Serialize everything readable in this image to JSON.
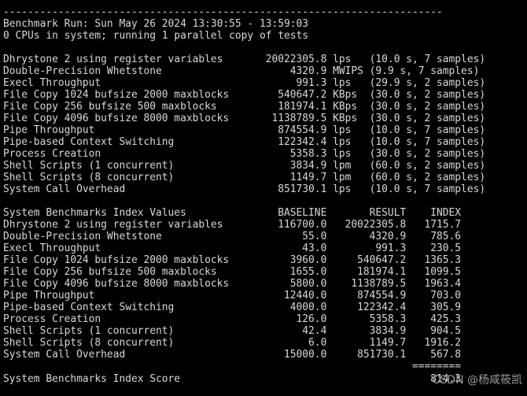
{
  "terminal": {
    "lines": [
      "------------------------------------------------------------------------",
      "Benchmark Run: Sun May 26 2024 13:30:55 - 13:59:03",
      "0 CPUs in system; running 1 parallel copy of tests",
      "",
      "Dhrystone 2 using register variables       20022305.8 lps   (10.0 s, 7 samples)",
      "Double-Precision Whetstone                     4320.9 MWIPS (9.9 s, 7 samples)",
      "Execl Throughput                                991.3 lps   (29.9 s, 2 samples)",
      "File Copy 1024 bufsize 2000 maxblocks        540647.2 KBps  (30.0 s, 2 samples)",
      "File Copy 256 bufsize 500 maxblocks          181974.1 KBps  (30.0 s, 2 samples)",
      "File Copy 4096 bufsize 8000 maxblocks       1138789.5 KBps  (30.0 s, 2 samples)",
      "Pipe Throughput                              874554.9 lps   (10.0 s, 7 samples)",
      "Pipe-based Context Switching                 122342.4 lps   (10.0 s, 7 samples)",
      "Process Creation                               5358.3 lps   (30.0 s, 2 samples)",
      "Shell Scripts (1 concurrent)                   3834.9 lpm   (60.0 s, 2 samples)",
      "Shell Scripts (8 concurrent)                   1149.7 lpm   (60.0 s, 2 samples)",
      "System Call Overhead                         851730.1 lps   (10.0 s, 7 samples)",
      "",
      "System Benchmarks Index Values               BASELINE       RESULT    INDEX",
      "Dhrystone 2 using register variables         116700.0   20022305.8   1715.7",
      "Double-Precision Whetstone                       55.0       4320.9    785.6",
      "Execl Throughput                                 43.0        991.3    230.5",
      "File Copy 1024 bufsize 2000 maxblocks          3960.0     540647.2   1365.3",
      "File Copy 256 bufsize 500 maxblocks            1655.0     181974.1   1099.5",
      "File Copy 4096 bufsize 8000 maxblocks          5800.0    1138789.5   1963.4",
      "Pipe Throughput                               12440.0     874554.9    703.0",
      "Pipe-based Context Switching                   4000.0     122342.4    305.9",
      "Process Creation                                126.0       5358.3    425.3",
      "Shell Scripts (1 concurrent)                     42.4       3834.9    904.5",
      "Shell Scripts (8 concurrent)                      6.0       1149.7   1916.2",
      "System Call Overhead                          15000.0     851730.1    567.8",
      "                                                                   ========",
      "",
      "System Benchmarks Index Score                                         814.3"
    ]
  },
  "watermark": "CSDN @杨咸筱凯"
}
